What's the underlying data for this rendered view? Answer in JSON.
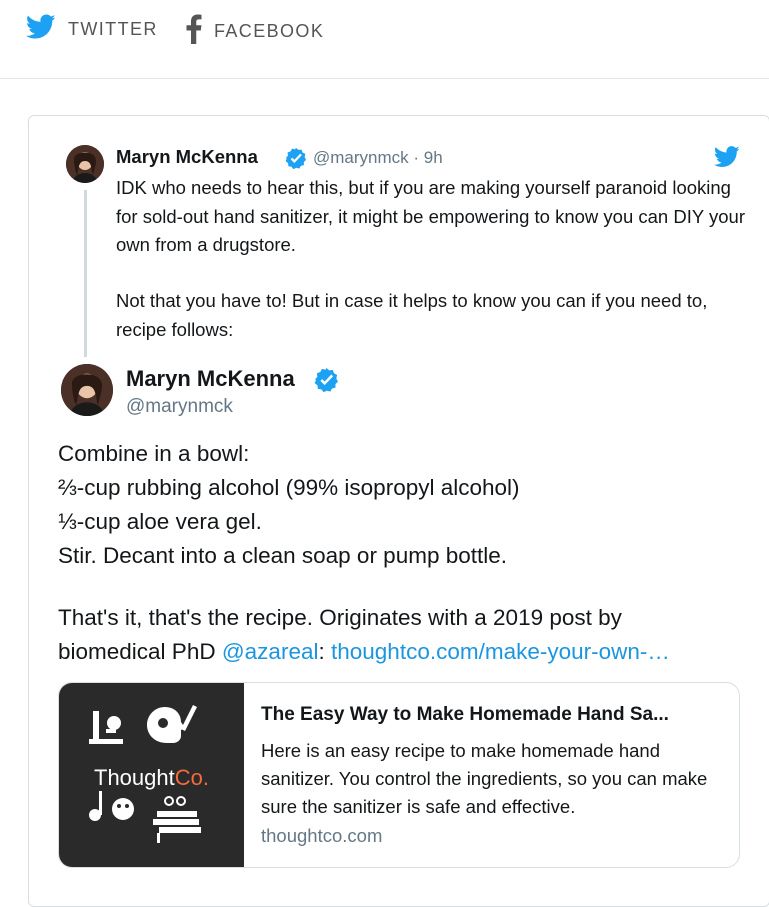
{
  "share": {
    "twitter_label": "TWITTER",
    "facebook_label": "FACEBOOK",
    "twitter_icon": "twitter-bird-icon",
    "facebook_icon": "facebook-f-icon"
  },
  "tweet_reply": {
    "author_name": "Maryn McKenna",
    "author_handle_time": "@marynmck · 9h",
    "paragraph_1": "IDK who needs to hear this, but if you are making yourself paranoid looking for sold-out hand sanitizer, it might be empowering to know you can DIY your own from a drugstore.",
    "paragraph_2": "Not that you have to! But in case it helps to know you can if you need to, recipe follows:"
  },
  "tweet_main": {
    "author_name": "Maryn McKenna",
    "author_handle": "@marynmck",
    "line_1": "Combine in a bowl:",
    "line_2": "⅔-cup rubbing alcohol (99% isopropyl alcohol)",
    "line_3": "⅓-cup aloe vera gel.",
    "line_4": "Stir. Decant into a clean soap or pump bottle.",
    "line_5": "That's it, that's the recipe. Originates with a 2019 post by",
    "line_6_prefix": "biomedical PhD ",
    "mention": "@azareal",
    "line_6_colon": ":",
    "url_text": "thoughtco.com/make-your-own-…"
  },
  "link_card": {
    "thumb_brand_main": "Thought",
    "thumb_brand_accent": "Co.",
    "title": "The Easy Way to Make Homemade Hand Sa...",
    "description": "Here is an easy recipe to make homemade hand sanitizer. You control the ingredients, so you can make sure the sanitizer is safe and effective.",
    "domain": "thoughtco.com"
  },
  "colors": {
    "twitter_blue": "#1da1f2",
    "link_blue": "#1b95e0",
    "brand_orange": "#f26b3a"
  }
}
